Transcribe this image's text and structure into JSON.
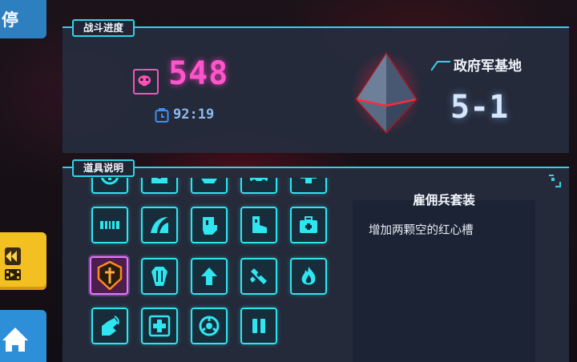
{
  "left_rail": {
    "pause_label": "停",
    "rewind_icon": "rewind-video-icon",
    "home_icon": "home-icon"
  },
  "battle_panel": {
    "tab_label": "战斗进度",
    "score": "548",
    "timer": "92:19",
    "stage_name": "政府军基地",
    "stage_level": "5-1"
  },
  "items_panel": {
    "tab_label": "道具说明",
    "selected_item": {
      "title": "雇佣兵套装",
      "description": "增加两颗空的红心槽"
    },
    "grid_icons": [
      [
        "coin-icon",
        "chest-icon",
        "cup-icon",
        "car-icon",
        "health-cross-icon"
      ],
      [
        "belt-icon",
        "wave-icon",
        "glove-icon",
        "boot-icon",
        "medkit-icon"
      ],
      [
        "dagger-shield-icon",
        "coffin-icon",
        "arrow-up-icon",
        "rocket-icon",
        "fire-icon"
      ],
      [
        "hand-fire-icon",
        "plus-icon",
        "target-icon",
        "pause-bars-icon"
      ]
    ]
  },
  "colors": {
    "accent": "#2fd3e6",
    "score": "#ff55cc",
    "selected": "#e07aff",
    "panel": "#262d3e"
  }
}
